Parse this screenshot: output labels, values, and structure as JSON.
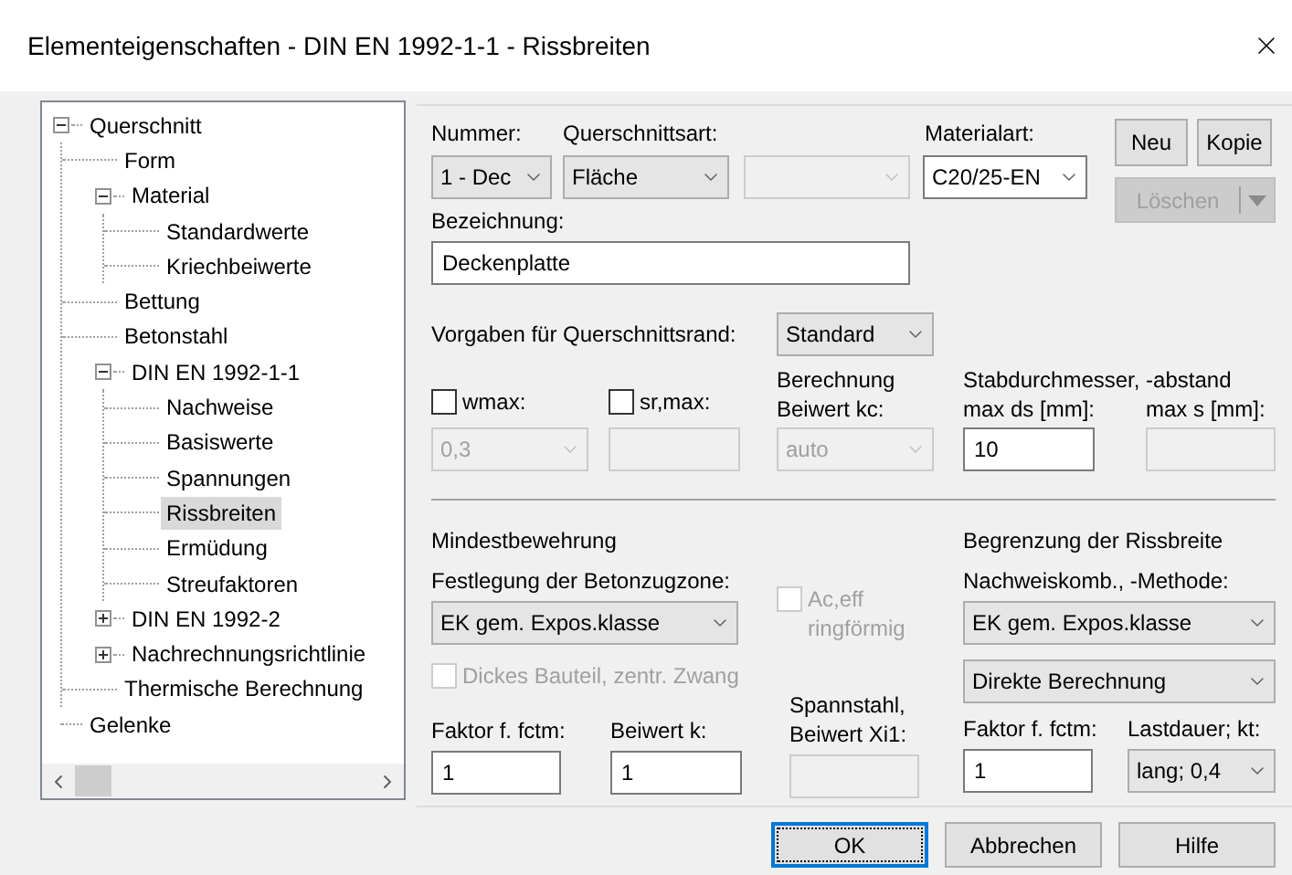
{
  "window": {
    "title": "Elementeigenschaften - DIN EN 1992-1-1 - Rissbreiten"
  },
  "tree": [
    {
      "label": "Querschnitt",
      "expanded": true,
      "selected": false,
      "children": [
        {
          "label": "Form",
          "selected": false
        },
        {
          "label": "Material",
          "expanded": true,
          "selected": false,
          "children": [
            {
              "label": "Standardwerte",
              "selected": false
            },
            {
              "label": "Kriechbeiwerte",
              "selected": false
            }
          ]
        },
        {
          "label": "Bettung",
          "selected": false
        },
        {
          "label": "Betonstahl",
          "selected": false
        },
        {
          "label": "DIN EN 1992-1-1",
          "expanded": true,
          "selected": false,
          "children": [
            {
              "label": "Nachweise",
              "selected": false
            },
            {
              "label": "Basiswerte",
              "selected": false
            },
            {
              "label": "Spannungen",
              "selected": false
            },
            {
              "label": "Rissbreiten",
              "selected": true
            },
            {
              "label": "Ermüdung",
              "selected": false
            },
            {
              "label": "Streufaktoren",
              "selected": false
            }
          ]
        },
        {
          "label": "DIN EN 1992-2",
          "expanded": false,
          "selected": false
        },
        {
          "label": "Nachrechnungsrichtlinie",
          "expanded": false,
          "selected": false
        },
        {
          "label": "Thermische Berechnung",
          "selected": false
        }
      ]
    },
    {
      "label": "Gelenke",
      "selected": false
    }
  ],
  "header": {
    "number": {
      "label": "Nummer:",
      "value": "1 - Dec",
      "disabled": false
    },
    "section_type": {
      "label": "Querschnittsart:",
      "value": "Fläche",
      "disabled": false
    },
    "section_subtype": {
      "disabled": true
    },
    "material_type": {
      "label": "Materialart:",
      "value": "C20/25-EN",
      "disabled": false,
      "editable": true
    },
    "buttons": [
      {
        "label": "Neu",
        "disabled": false
      },
      {
        "label": "Kopie",
        "disabled": false
      }
    ],
    "delete_button": {
      "label": "Löschen",
      "disabled": true
    },
    "designation": {
      "label": "Bezeichnung:",
      "value": "Deckenplatte"
    },
    "edge_defaults": {
      "label": "Vorgaben für Querschnittsrand:",
      "value": "Standard",
      "disabled": false
    }
  },
  "crack_settings": {
    "wmax": {
      "label": "wmax:",
      "checked": false,
      "value": "0,3",
      "field_disabled": true
    },
    "sr_max": {
      "label": "sr,max:",
      "checked": false,
      "field_disabled": true
    },
    "kc": {
      "label": "Berechnung Beiwert kc:",
      "value": "auto",
      "disabled": true
    },
    "bar_group_label": "Stabdurchmesser, -abstand",
    "max_ds": {
      "label": "max ds [mm]:",
      "value": "10",
      "disabled": false
    },
    "max_s": {
      "label": "max s [mm]:",
      "disabled": true
    }
  },
  "minimum_reinforcement": {
    "title": "Mindestbewehrung",
    "tension_zone": {
      "label": "Festlegung der Betonzugzone:",
      "value": "EK gem. Expos.klasse",
      "disabled": false
    },
    "ring_shaped": {
      "label": "Ac,eff ringförmig",
      "checked": false,
      "disabled": true
    },
    "thick_member": {
      "label": "Dickes Bauteil, zentr. Zwang",
      "checked": false,
      "disabled": true
    },
    "fctm_factor": {
      "label": "Faktor f. fctm:",
      "value": "1",
      "disabled": false
    },
    "k_coefficient": {
      "label": "Beiwert k:",
      "value": "1",
      "disabled": false
    },
    "prestressing_xi1": {
      "label": "Spannstahl, Beiwert Xi1:",
      "disabled": true
    }
  },
  "crack_width_limit": {
    "title": "Begrenzung der Rissbreite",
    "method": {
      "label": "Nachweiskomb., -Methode:",
      "value": "EK gem. Expos.klasse",
      "disabled": false
    },
    "calculation": {
      "value": "Direkte Berechnung",
      "disabled": false
    },
    "fctm_factor": {
      "label": "Faktor f. fctm:",
      "value": "1",
      "disabled": false
    },
    "load_duration": {
      "label": "Lastdauer; kt:",
      "value": "lang; 0,4",
      "disabled": false
    }
  },
  "buttons": [
    {
      "label": "OK",
      "focused": true
    },
    {
      "label": "Abbrechen",
      "focused": false
    },
    {
      "label": "Hilfe",
      "focused": false
    }
  ]
}
